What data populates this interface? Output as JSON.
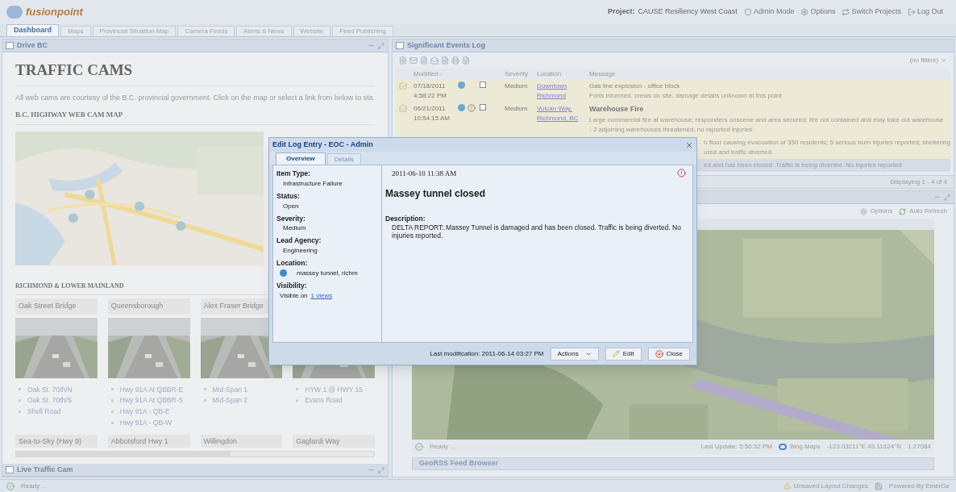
{
  "header": {
    "logo": "fusionpoint",
    "project_label": "Project:",
    "project": "CAUSE Resiliency West Coast",
    "links": [
      "Admin Mode",
      "Options",
      "Switch Projects",
      "Log Out"
    ]
  },
  "tabs": [
    {
      "label": "Dashboard",
      "selected": true
    },
    {
      "label": "Maps",
      "selected": false
    },
    {
      "label": "Provincial Situation Map",
      "selected": false
    },
    {
      "label": "Camera Feeds",
      "selected": false
    },
    {
      "label": "Alerts & News",
      "selected": false
    },
    {
      "label": "Website",
      "selected": false
    },
    {
      "label": "Feed Publishing",
      "selected": false
    }
  ],
  "drive_bc": {
    "title": "Drive BC",
    "heading": "TRAFFIC CAMS",
    "intro": "All web cams are courtesy of the B.C. provincial government. Click on the map or select a link from below to sta",
    "map_heading": "B.C. HIGHWAY WEB CAM MAP",
    "region_heading": "RICHMOND & LOWER MAINLAND",
    "cameras": [
      {
        "name": "Oak Street Bridge",
        "links": [
          "Oak St. 70th/N",
          "Oak St. 70th/S",
          "Shell Road"
        ]
      },
      {
        "name": "Queensborough",
        "links": [
          "Hwy 91A At QBBR-E",
          "Hwy 91A At QBBR-S",
          "Hwy 91A - QB-E",
          "Hwy 91A - QB-W"
        ]
      },
      {
        "name": "Alex Fraser Bridge",
        "links": [
          "Mid-Span 1",
          "Mid-Span 2"
        ]
      },
      {
        "links": [
          "HYW 1 @ HWY 15",
          "Evans Road"
        ]
      }
    ],
    "more_cameras": [
      "Sea-to-Sky (Hwy 9)",
      "Abbotsford Hwy 1",
      "Willingdon",
      "Gaglardi Way"
    ]
  },
  "live_traffic_cam": {
    "title": "Live Traffic Cam"
  },
  "events_log": {
    "title": "Significant Events Log",
    "filter": "(no filters)",
    "columns": [
      "Modified",
      "Severity",
      "Location",
      "Message"
    ],
    "rows": [
      {
        "kind": "full",
        "selected": false,
        "date": "07/18/2011",
        "time": "4:58:22 PM",
        "alert": false,
        "severity": "Medium",
        "location": "Downtown Richmond",
        "unread": false,
        "title": "Gas line explosion - office block",
        "detail": "Forts informed, crews on site, damage details unknown at this point"
      },
      {
        "kind": "full",
        "selected": false,
        "date": "06/21/2011",
        "time": "10:54:15 AM",
        "alert": true,
        "severity": "Medium",
        "location": "Vulcan Way, Richmond, BC",
        "unread": true,
        "title": "Warehouse Fire",
        "detail": "Large commercial fire at warehouse; responders onscene and area secured; fire not contained and may take out warehouse - 2 adjoining warehouses threatened; no reported injuries."
      },
      {
        "kind": "partial",
        "selected": false,
        "lines": [
          "h floor causing evacuation of 350 residents; 5 serious burn injuries reported; sheltering",
          "ured and traffic diverted."
        ]
      },
      {
        "kind": "partial",
        "selected": true,
        "lines": [
          "ed and has been closed. Traffic is being diverted. No injuries reported"
        ]
      }
    ],
    "footer": "Displaying 1 - 4 of 4"
  },
  "map_panel": {
    "toolbar": [
      "Options",
      "Auto Refresh"
    ],
    "status": {
      "ready": "Ready ...",
      "last_update": "Last Update: 5:50:32 PM",
      "provider": "Bing Maps",
      "coordinates": "-123.03211°E 49.11624°N",
      "scale": "1.27084"
    }
  },
  "georss": {
    "title": "GeoRSS Feed Browser"
  },
  "status_bar": {
    "left": "Ready ...",
    "unsaved": "Unsaved Layout Changes",
    "powered": "Powered By EmerGe"
  },
  "dialog": {
    "title": "Edit Log Entry - EOC - Admin",
    "tabs": [
      {
        "label": "Overview",
        "selected": true
      },
      {
        "label": "Details",
        "selected": false
      }
    ],
    "fields": [
      {
        "kind": "text",
        "label": "Item Type:",
        "value": "Infrastructure Failure"
      },
      {
        "kind": "text",
        "label": "Status:",
        "value": "Open"
      },
      {
        "kind": "text",
        "label": "Severity:",
        "value": "Medium"
      },
      {
        "kind": "text",
        "label": "Lead Agency:",
        "value": "Engineering"
      },
      {
        "kind": "location",
        "label": "Location:",
        "value": "massey tunnel, richm"
      },
      {
        "kind": "link",
        "label": "Visibility:",
        "value": "Visible on",
        "link": "1 views"
      }
    ],
    "date": "2011-06-10 11:38 AM",
    "alert": true,
    "headline": "Massey tunnel closed",
    "description_label": "Description:",
    "description": "DELTA REPORT: Massey Tunnel is damaged and has been closed. Traffic is being diverted. No injuries reported.",
    "last_modification": "Last modification: 2011-06-14 03:27 PM",
    "buttons": [
      "Actions",
      "Edit",
      "Close"
    ]
  }
}
